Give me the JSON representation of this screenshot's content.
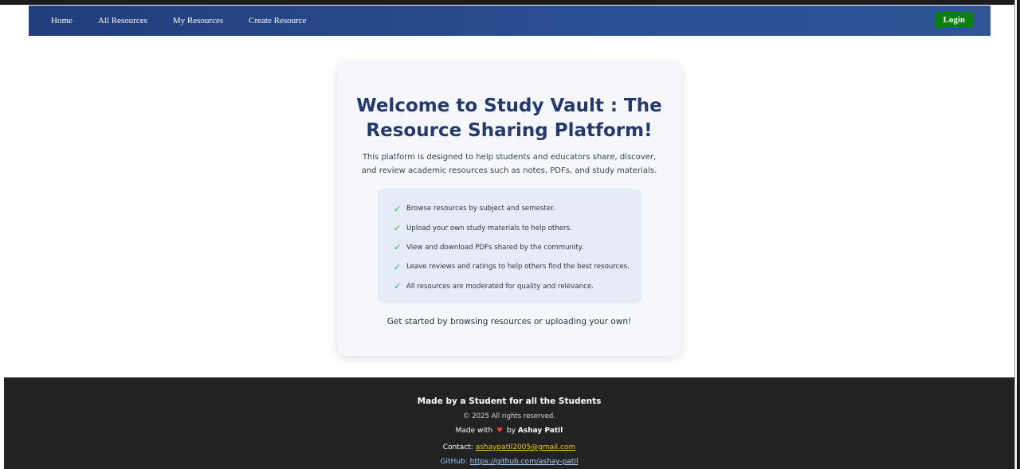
{
  "nav": {
    "links": [
      "Home",
      "All Resources",
      "My Resources",
      "Create Resource"
    ],
    "login": "Login"
  },
  "hero": {
    "title_line1": "Welcome to Study Vault : The",
    "title_line2": "Resource Sharing Platform!",
    "description": "This platform is designed to help students and educators share, discover, and review academic resources such as notes, PDFs, and study materials.",
    "features": [
      "Browse resources by subject and semester.",
      "Upload your own study materials to help others.",
      "View and download PDFs shared by the community.",
      "Leave reviews and ratings to help others find the best resources.",
      "All resources are moderated for quality and relevance."
    ],
    "feature_icon": "check-icon",
    "cta": "Get started by browsing resources or uploading your own!"
  },
  "footer": {
    "tagline": "Made by a Student for all the Students",
    "copyright": "© 2025 All rights reserved.",
    "made_with": "Made with",
    "heart": "♥",
    "by": "by",
    "author": "Ashay Patil",
    "contact_label": "Contact:",
    "email": "ashaypatil2005@gmail.com",
    "github_label": "GitHub:",
    "github_url": "https://github.com/ashay-patil"
  },
  "colors": {
    "navbar": "#2a4f93",
    "login_button": "#0b7f12",
    "title": "#26396b",
    "check": "#2eae4a",
    "footer": "#222222",
    "email_link": "#f0c52e",
    "github_link": "#a9d4ff"
  }
}
